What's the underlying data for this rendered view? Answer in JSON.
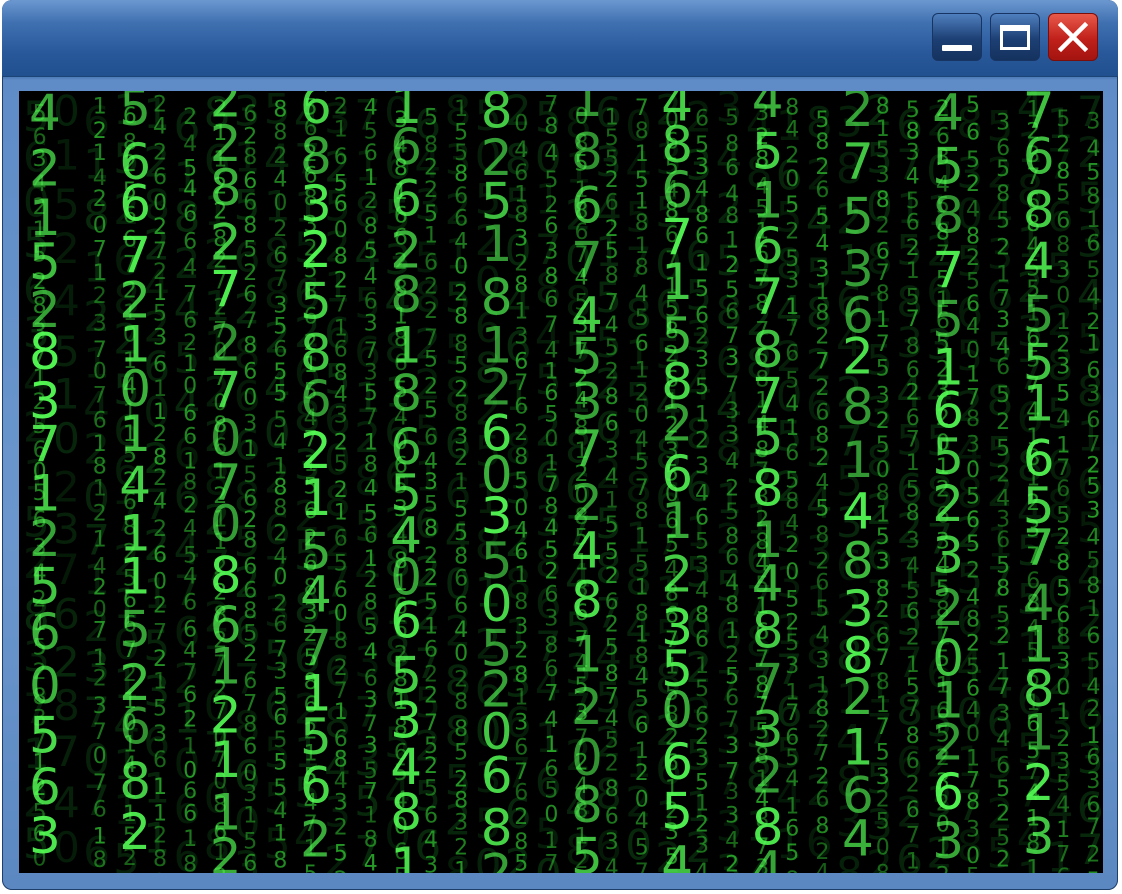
{
  "window": {
    "controls": {
      "minimize_icon": "minimize-icon",
      "maximize_icon": "maximize-icon",
      "close_icon": "close-icon"
    }
  },
  "colors": {
    "frame": "#5a87c2",
    "close": "#c82319",
    "rain_bright": "#55ff55",
    "rain_mid": "#33cc33",
    "rain_dim": "#0f4a16",
    "background": "#000000"
  },
  "matrix": {
    "columns": [
      "5605634215283712",
      "0152451023762874",
      "6181214207123707",
      "1526825667210141",
      "1282426027215361",
      "6182454664762106",
      "8612112282727070",
      "3156286685267860",
      "5418824026735655",
      "4715626832586215",
      "3252165608271684",
      "7184561285463735",
      "0653481662818654",
      "6435822516227525",
      "8321558664028852",
      "5052068251812603",
      "2850461832813676",
      "5017845263867416",
      "8120851867453724",
      "6341552625874528",
      "0457815181845612",
      "2350654867158261",
      "2346534861562351",
      "3425864812567373",
      "4873284516787581",
      "1658420525317654",
      "8245826543182726",
      "3821642753628148",
      "2508153826781753",
      "6715834562157862",
      "2012634587516523",
      "8305652482564017",
      "5243658521734652",
      "4181237684551657",
      "1765285683012354",
      "7253458165421636"
    ]
  }
}
